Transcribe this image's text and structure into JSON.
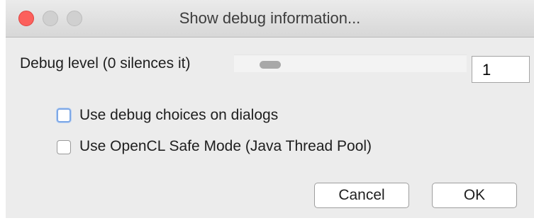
{
  "window": {
    "title": "Show debug information..."
  },
  "debug_level": {
    "label": "Debug level (0 silences it)",
    "value": "1",
    "slider_fraction": 0.12
  },
  "options": [
    {
      "label": "Use debug choices on dialogs",
      "checked": false,
      "focused": true
    },
    {
      "label": "Use OpenCL Safe Mode (Java Thread Pool)",
      "checked": false,
      "focused": false
    }
  ],
  "buttons": {
    "cancel": "Cancel",
    "ok": "OK"
  },
  "colors": {
    "close_button": "#fc605c",
    "focus_ring": "#7ea8e6",
    "window_bg": "#ececec"
  }
}
